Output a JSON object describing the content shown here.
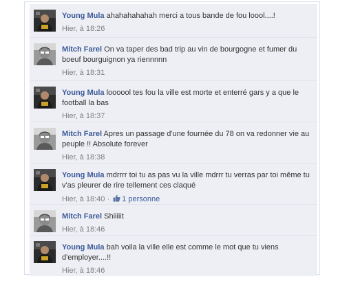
{
  "comments": [
    {
      "author": "Young Mula",
      "text": "ahahahahahah merci a tous bande de fou loool....!",
      "time": "Hier, à 18:26",
      "avatar_icon": "profile-photo-young-mula"
    },
    {
      "author": "Mitch Farel",
      "text": "On va taper des bad trip au vin de bourgogne et fumer du boeuf bourguignon ya riennnnn",
      "time": "Hier, à 18:31",
      "avatar_icon": "profile-photo-mitch-farel"
    },
    {
      "author": "Young Mula",
      "text": "loooool tes fou la ville est morte et enterré gars y a que le football la bas",
      "time": "Hier, à 18:37",
      "avatar_icon": "profile-photo-young-mula"
    },
    {
      "author": "Mitch Farel",
      "text": "Apres un passage d'une fournée du 78 on va redonner vie au peuple !! Absolute forever",
      "time": "Hier, à 18:38",
      "avatar_icon": "profile-photo-mitch-farel"
    },
    {
      "author": "Young Mula",
      "text": "mdrrrr toi tu as pas vu la ville mdrrr tu verras par toi même tu v'as pleurer de rire tellement ces claqué",
      "time": "Hier, à 18:40",
      "separator": "·",
      "likes": "1 personne",
      "avatar_icon": "profile-photo-young-mula"
    },
    {
      "author": "Mitch Farel",
      "text": "Shiiiiit",
      "time": "Hier, à 18:46",
      "avatar_icon": "profile-photo-mitch-farel"
    },
    {
      "author": "Young Mula",
      "text": "bah voila la ville elle est comme le mot que tu viens d'employer....!!",
      "time": "Hier, à 18:46",
      "avatar_icon": "profile-photo-young-mula"
    }
  ],
  "colors": {
    "author_link": "#3b5998",
    "comment_bg": "#edeff4",
    "meta_text": "#7f7f7f"
  }
}
